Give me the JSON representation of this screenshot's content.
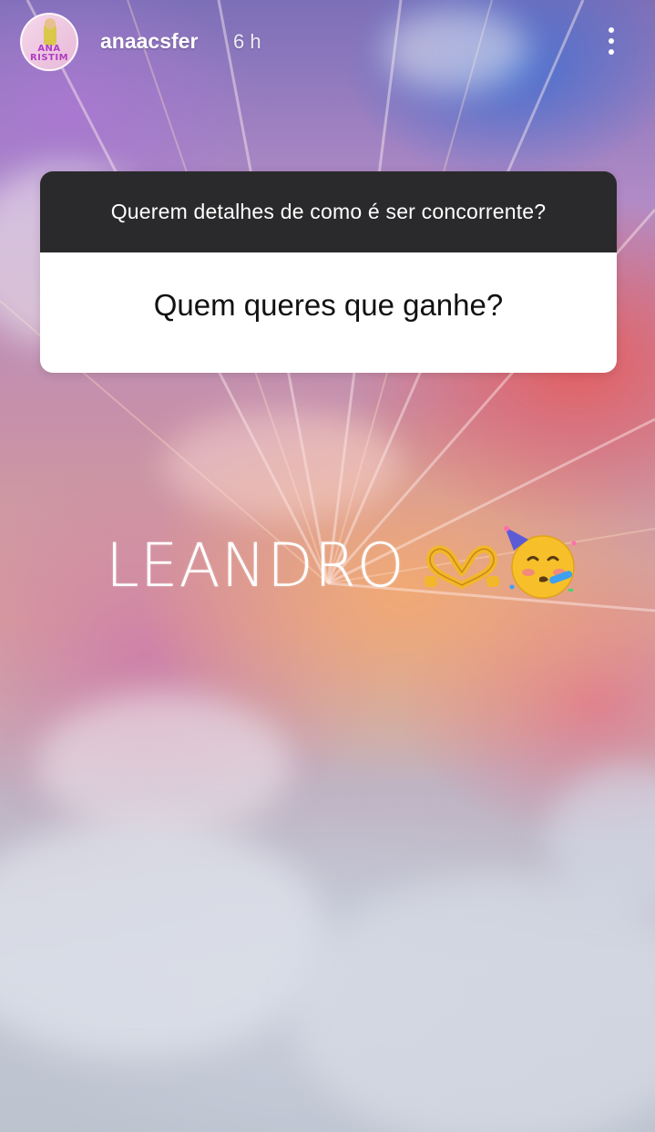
{
  "header": {
    "username": "anaacsfer",
    "time_ago": "6 h",
    "avatar_text": "ANA\nRISTIM"
  },
  "sticker": {
    "question": "Querem detalhes de como é ser concorrente?",
    "answer": "Quem queres que ganhe?"
  },
  "caption": {
    "text": "LEANDRO",
    "emojis": [
      "heart-hands-emoji",
      "partying-face-emoji"
    ]
  },
  "colors": {
    "sticker_header": "#2a2a2c",
    "sticker_body": "#ffffff",
    "text_light": "#ffffff"
  }
}
